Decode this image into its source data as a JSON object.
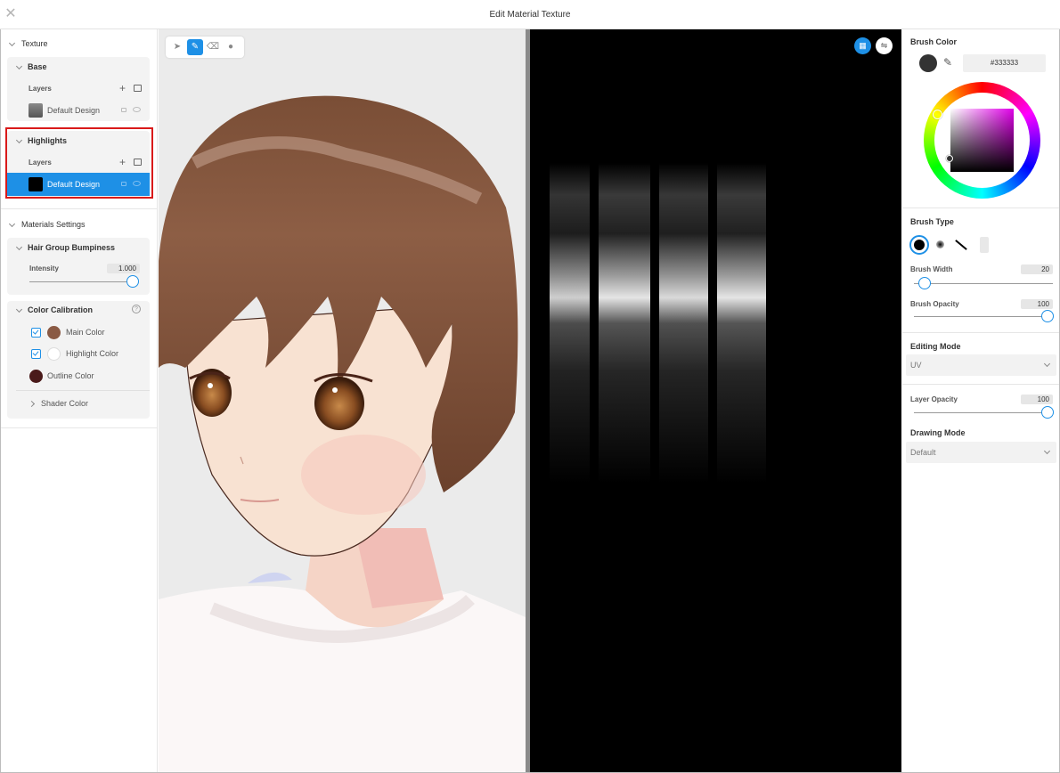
{
  "window": {
    "title": "Edit Material Texture",
    "close_icon": "close-icon"
  },
  "left_panel": {
    "texture_header": "Texture",
    "base": {
      "title": "Base",
      "layers_label": "Layers",
      "layer_name": "Default Design"
    },
    "highlights": {
      "title": "Highlights",
      "layers_label": "Layers",
      "layer_name": "Default Design"
    },
    "materials_header": "Materials Settings",
    "hair_bumpiness": {
      "title": "Hair Group Bumpiness",
      "intensity_label": "Intensity",
      "intensity_value": "1.000",
      "slider_fraction": 1.0
    },
    "color_calibration": {
      "title": "Color Calibration",
      "help_icon": "help-icon",
      "items": [
        {
          "label": "Main Color",
          "color": "#8a5a44",
          "checked": true
        },
        {
          "label": "Highlight Color",
          "color": "#ffffff",
          "checked": true
        },
        {
          "label": "Outline Color",
          "color": "#4a1a1a",
          "checked": false
        }
      ]
    },
    "shader_color": "Shader Color"
  },
  "viewport": {
    "tools": [
      "select-tool",
      "brush-tool",
      "eraser-tool",
      "fill-tool"
    ],
    "active_tool": "brush-tool"
  },
  "texture_view": {
    "buttons": [
      "grid-view-icon",
      "mirror-icon"
    ]
  },
  "right_panel": {
    "brush_color_title": "Brush Color",
    "brush_color_hex": "#333333",
    "current_color": "#333333",
    "brush_type_title": "Brush Type",
    "brush_width_label": "Brush Width",
    "brush_width_value": "20",
    "brush_opacity_label": "Brush Opacity",
    "brush_opacity_value": "100",
    "editing_mode_title": "Editing Mode",
    "editing_mode_value": "UV",
    "layer_opacity_label": "Layer Opacity",
    "layer_opacity_value": "100",
    "drawing_mode_title": "Drawing Mode",
    "drawing_mode_value": "Default"
  }
}
